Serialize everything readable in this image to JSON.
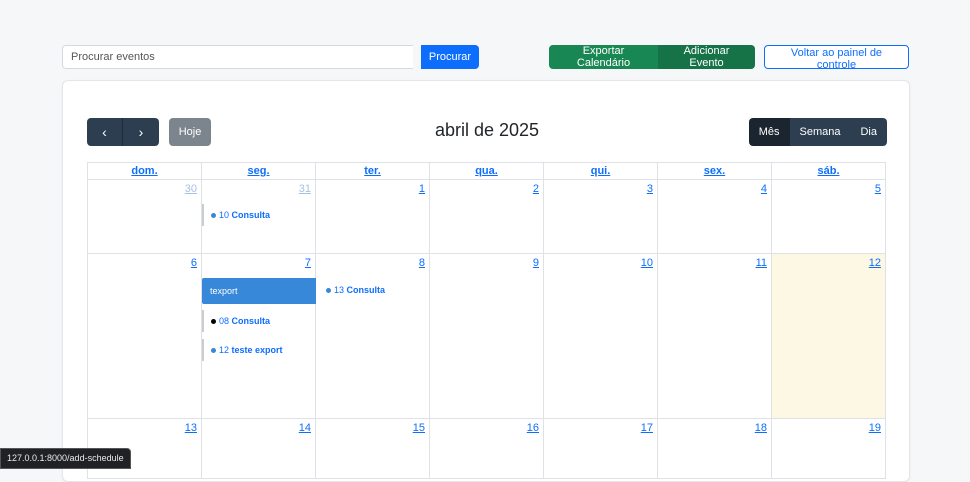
{
  "search": {
    "placeholder": "Procurar eventos",
    "button": "Procurar"
  },
  "actions": {
    "export": "Exportar Calendário",
    "add": "Adicionar Evento",
    "back": "Voltar ao painel de controle"
  },
  "toolbar": {
    "prev": "‹",
    "next": "›",
    "today": "Hoje",
    "title": "abril de 2025",
    "views": [
      "Mês",
      "Semana",
      "Dia"
    ]
  },
  "weekdays": [
    "dom.",
    "seg.",
    "ter.",
    "qua.",
    "qui.",
    "sex.",
    "sáb."
  ],
  "weeks": [
    [
      "30",
      "31",
      "1",
      "2",
      "3",
      "4",
      "5"
    ],
    [
      "6",
      "7",
      "8",
      "9",
      "10",
      "11",
      "12"
    ],
    [
      "13",
      "14",
      "15",
      "16",
      "17",
      "18",
      "19"
    ]
  ],
  "events": {
    "e1": {
      "time": "10",
      "title": "Consulta"
    },
    "e2": {
      "title": "texport"
    },
    "e3": {
      "time": "13",
      "title": "Consulta"
    },
    "e4": {
      "time": "08",
      "title": "Consulta"
    },
    "e5": {
      "time": "12",
      "title": "teste export"
    }
  },
  "status_url": "127.0.0.1:8000/add-schedule",
  "colors": {
    "primary": "#0d6efd",
    "success": "#198754",
    "dark": "#2c3e50",
    "event": "#3788d8",
    "today": "#fcf8e3"
  }
}
